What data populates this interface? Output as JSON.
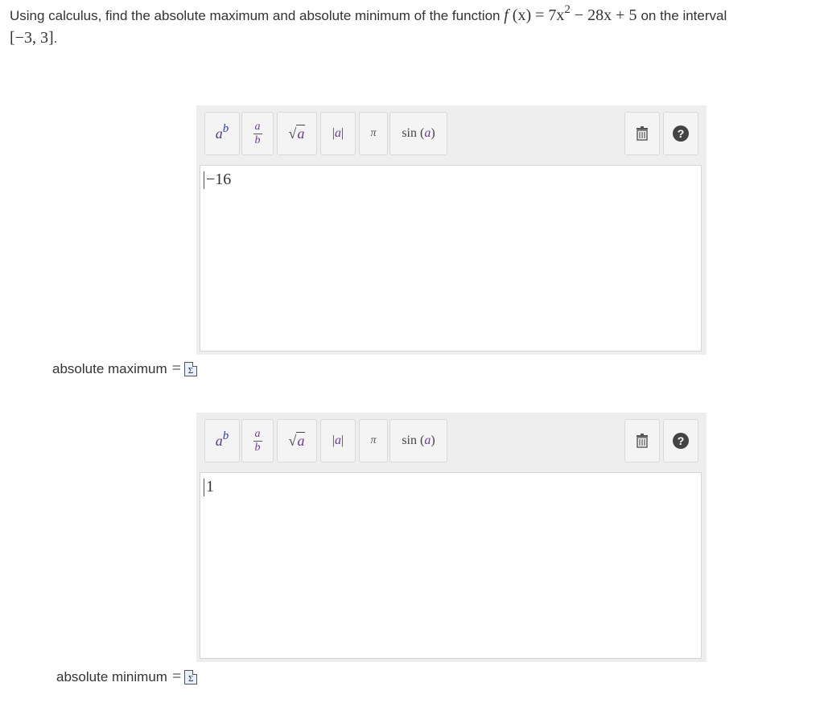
{
  "question": {
    "text_before": "Using calculus, find the absolute maximum and absolute minimum of the function",
    "function_name": "f",
    "function_arg": "(x) = 7x",
    "exponent": "2",
    "function_rest": " − 28x + 5",
    "text_middle": "on the interval",
    "interval": "[−3, 3]",
    "period": "."
  },
  "toolbar": {
    "power_base": "a",
    "power_exp": "b",
    "fraction_num": "a",
    "fraction_den": "b",
    "sqrt_symbol": "√",
    "sqrt_arg": "a",
    "abs_left": "|",
    "abs_arg": "a",
    "abs_right": "|",
    "pi": "π",
    "sin_label": "sin (",
    "sin_arg": "a",
    "sin_close": ")",
    "help_glyph": "?"
  },
  "editors": [
    {
      "value": "−16",
      "label": "absolute maximum",
      "equals": "="
    },
    {
      "value": "1",
      "label": "absolute minimum",
      "equals": "="
    }
  ],
  "icons": {
    "trash": "trash-icon",
    "help": "help-icon",
    "equation": "equation-editor-icon"
  }
}
